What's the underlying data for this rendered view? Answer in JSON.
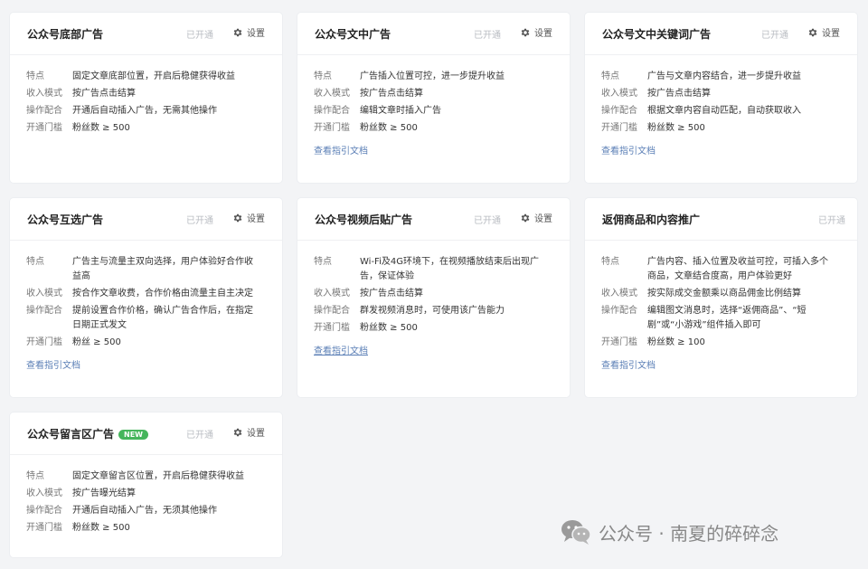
{
  "common": {
    "status_label": "已开通",
    "settings_label": "设置",
    "doc_link_label": "查看指引文档",
    "labels": {
      "feature": "特点",
      "income": "收入模式",
      "operation": "操作配合",
      "threshold": "开通门槛"
    }
  },
  "cards": [
    {
      "title": "公众号底部广告",
      "feature": "固定文章底部位置，开启后稳健获得收益",
      "income": "按广告点击结算",
      "operation": "开通后自动插入广告，无需其他操作",
      "threshold": "粉丝数 ≥ 500"
    },
    {
      "title": "公众号文中广告",
      "feature": "广告插入位置可控，进一步提升收益",
      "income": "按广告点击结算",
      "operation": "编辑文章时插入广告",
      "threshold": "粉丝数 ≥ 500"
    },
    {
      "title": "公众号文中关键词广告",
      "feature": "广告与文章内容结合，进一步提升收益",
      "income": "按广告点击结算",
      "operation": "根据文章内容自动匹配，自动获取收入",
      "threshold": "粉丝数 ≥ 500"
    },
    {
      "title": "公众号互选广告",
      "feature": "广告主与流量主双向选择，用户体验好合作收益高",
      "income": "按合作文章收费，合作价格由流量主自主决定",
      "operation": "提前设置合作价格，确认广告合作后，在指定日期正式发文",
      "threshold": "粉丝 ≥ 500"
    },
    {
      "title": "公众号视频后贴广告",
      "feature": "Wi-Fi及4G环境下，在视频播放结束后出现广告，保证体验",
      "income": "按广告点击结算",
      "operation": "群发视频消息时，可使用该广告能力",
      "threshold": "粉丝数 ≥ 500"
    },
    {
      "title": "返佣商品和内容推广",
      "feature": "广告内容、插入位置及收益可控，可插入多个商品，文章结合度高，用户体验更好",
      "income": "按实际成交金额乘以商品佣金比例结算",
      "operation": "编辑图文消息时，选择“返佣商品”、“短剧”或“小游戏”组件插入即可",
      "threshold": "粉丝数 ≥ 100"
    },
    {
      "title": "公众号留言区广告",
      "badge": "NEW",
      "feature": "固定文章留言区位置，开启后稳健获得收益",
      "income": "按广告曝光结算",
      "operation": "开通后自动插入广告，无须其他操作",
      "threshold": "粉丝数 ≥ 500"
    }
  ],
  "watermark": {
    "text": "公众号 · 南夏的碎碎念"
  },
  "colors": {
    "accent_link": "#5b7fb6",
    "badge_green": "#45b55b",
    "background": "#f3f4f6"
  }
}
